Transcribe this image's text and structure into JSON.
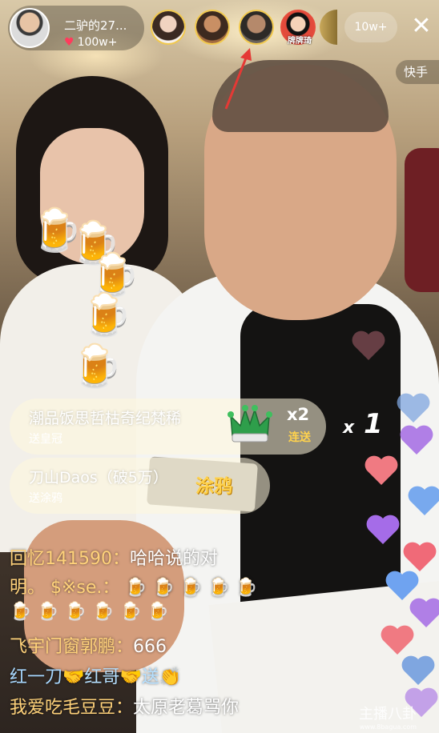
{
  "host": {
    "name": "二驴的27...",
    "likes": "100w+"
  },
  "viewers": [
    {
      "icon": "viewer-avatar-1"
    },
    {
      "icon": "viewer-avatar-2"
    },
    {
      "icon": "viewer-avatar-3"
    },
    {
      "icon": "viewer-avatar-4",
      "label": "牌牌琦"
    }
  ],
  "viewer_count": "10w+",
  "kuai_label": "快手",
  "gifts": [
    {
      "name": "潮品饭思哲枯奇纪梵稀",
      "action": "送皇冠",
      "multiplier": "x2",
      "combo": "连送"
    },
    {
      "name": "刀山Daos（破5万）",
      "action": "送涂鸦",
      "gift_text": "涂鸦"
    }
  ],
  "combo_counter": {
    "x": "x",
    "n": "1"
  },
  "comments": [
    {
      "name": "回忆141590：",
      "text": "哈哈说的对"
    },
    {
      "name": "明。 $※se.：",
      "text": ""
    },
    {
      "name": "飞宇门窗郭鹏：",
      "text": "666"
    },
    {
      "name": "红一刀",
      "text": "红哥",
      "suffix": "送"
    },
    {
      "name": "我爱吃毛豆豆：",
      "text": "太原老葛骂你"
    }
  ],
  "watermark": {
    "text": "主播八卦",
    "url": "www.8bagua.com"
  },
  "colors": {
    "gold": "#ffd24d",
    "heart_red": "#ff3b5c",
    "ring": "#f2c94c"
  }
}
